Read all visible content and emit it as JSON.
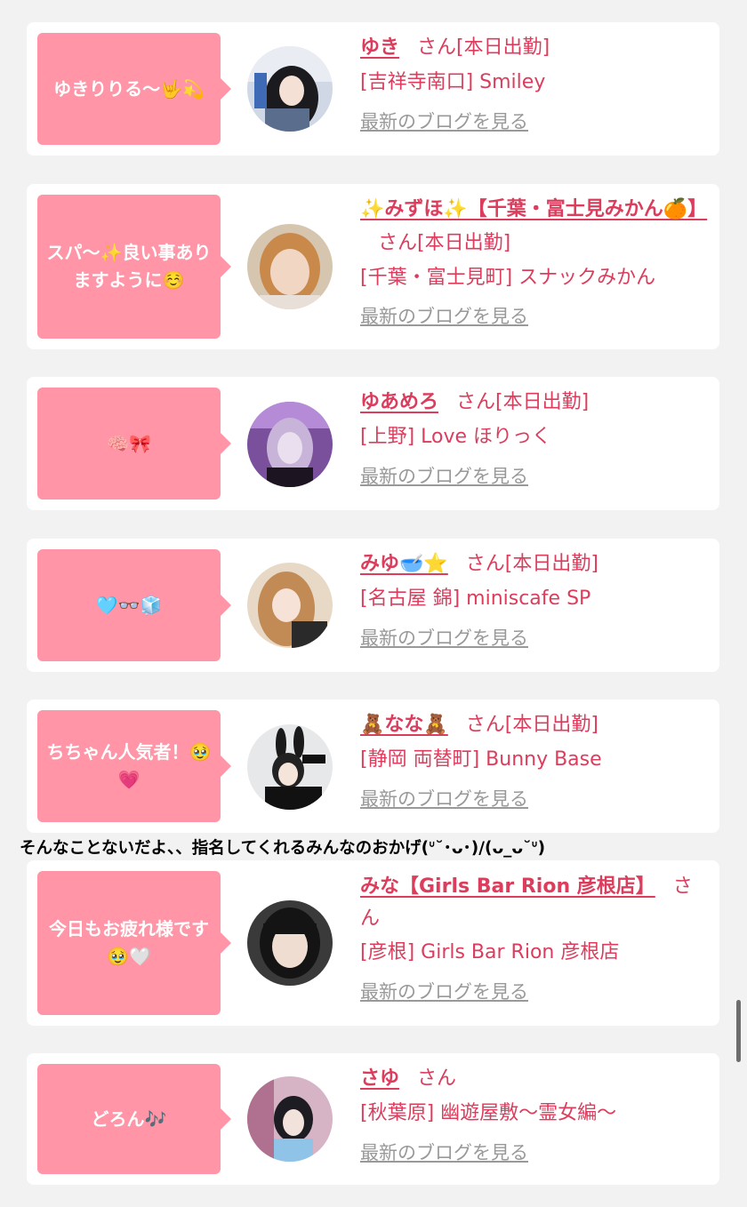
{
  "cards": [
    {
      "bubble": "ゆきりりる〜🤟💫",
      "name": "ゆき",
      "suffix": "さん[本日出勤]",
      "shop": "[吉祥寺南口] Smiley",
      "blog": "最新のブログを見る",
      "avatar": "avatar-photo-yuki"
    },
    {
      "bubble": "スパ〜✨良い事ありますように☺️",
      "name": "✨みずほ✨【千葉・富士見みかん🍊】",
      "suffix": "さん[本日出勤]",
      "shop": "[千葉・富士見町] スナックみかん",
      "blog": "最新のブログを見る",
      "avatar": "avatar-photo-mizuho"
    },
    {
      "bubble": "🧠🎀",
      "name": "ゆあめろ",
      "suffix": "さん[本日出勤]",
      "shop": "[上野] Love ほりっく",
      "blog": "最新のブログを見る",
      "avatar": "avatar-photo-yuamero"
    },
    {
      "bubble": "🩵👓🧊",
      "name": "みゆ🥣⭐️",
      "suffix": "さん[本日出勤]",
      "shop": "[名古屋 錦] miniscafe SP",
      "blog": "最新のブログを見る",
      "avatar": "avatar-photo-miyu"
    },
    {
      "bubble": "ちちゃん人気者！🥹💗",
      "name": "🧸なな🧸",
      "suffix": "さん[本日出勤]",
      "shop": "[静岡 両替町] Bunny Base",
      "blog": "最新のブログを見る",
      "avatar": "avatar-photo-nana"
    },
    {
      "bubble": "今日もお疲れ様です🥹🤍",
      "name": "みな【Girls Bar Rion 彦根店】",
      "suffix": "さん",
      "shop": "[彦根] Girls Bar Rion 彦根店",
      "blog": "最新のブログを見る",
      "avatar": "avatar-photo-mina"
    },
    {
      "bubble": "どろん🎶",
      "name": "さゆ",
      "suffix": "さん",
      "shop": "[秋葉原] 幽遊屋敷〜霊女編〜",
      "blog": "最新のブログを見る",
      "avatar": "avatar-photo-sayu"
    }
  ],
  "caption": "そんなことないだよ、、指名してくれるみんなのおかげ(ᐡ˘･ᴗ･)/(ᴗ_ᴗ˘ᐡ)",
  "colors": {
    "accent": "#dc3d5d",
    "bubble": "#ff95a6",
    "background": "#f2f2f2"
  }
}
